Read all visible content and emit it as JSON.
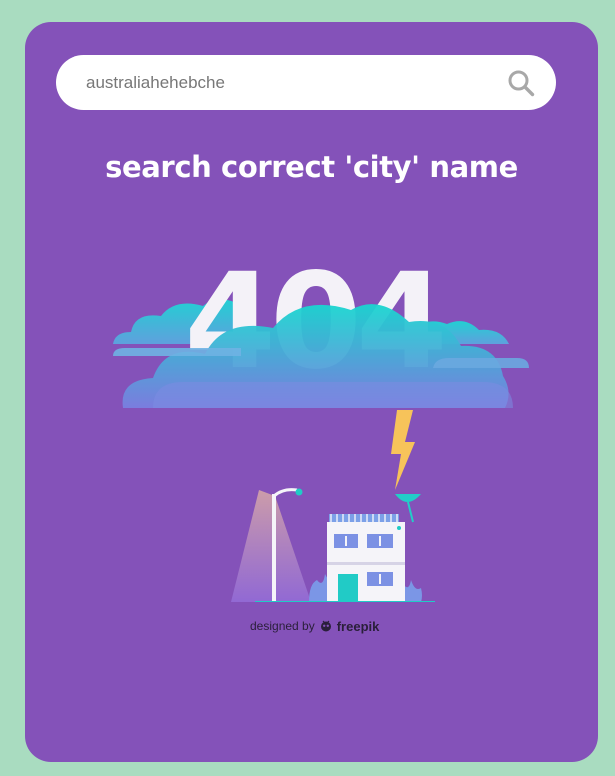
{
  "search": {
    "value": "australiahehebche",
    "icon": "search-icon"
  },
  "message": {
    "title": "search correct 'city' name"
  },
  "illustration": {
    "error_code": "404",
    "icons": [
      "cloud-icon",
      "lightning-icon",
      "street-lamp-icon",
      "house-icon"
    ]
  },
  "credit": {
    "prefix": "designed by",
    "brand": "freepik"
  },
  "colors": {
    "page_background": "#a9dcc0",
    "card_background": "#8452b9",
    "search_background": "#ffffff",
    "title_text": "#ffffff",
    "cloud_gradient_top": "#19d6d0",
    "cloud_gradient_bottom": "#7a7fe0",
    "lightning": "#f7c35a"
  }
}
